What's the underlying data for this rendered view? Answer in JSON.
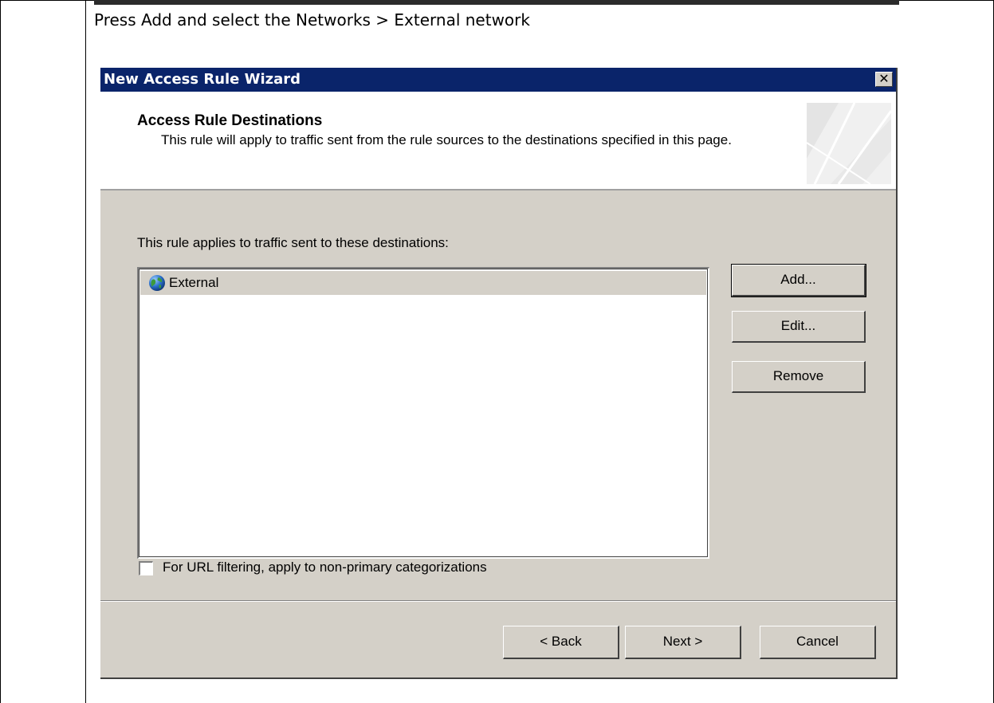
{
  "document": {
    "instruction": "Press Add and select the Networks > External network"
  },
  "dialog": {
    "title": "New Access Rule Wizard",
    "close_icon": "close-icon",
    "header": {
      "title": "Access Rule Destinations",
      "description": "This rule will apply to traffic sent from the rule sources to the destinations specified in this page."
    },
    "applies_label": "This rule applies to traffic sent to these destinations:",
    "destinations": [
      {
        "icon": "globe-icon",
        "label": "External"
      }
    ],
    "buttons": {
      "add": "Add...",
      "edit": "Edit...",
      "remove": "Remove"
    },
    "checkbox": {
      "label": "For URL filtering, apply to non-primary categorizations",
      "checked": false
    },
    "footer": {
      "back": "< Back",
      "next": "Next >",
      "cancel": "Cancel"
    },
    "colors": {
      "titlebar": "#0a246a",
      "dialog_bg": "#d4d0c8",
      "selection": "#d4d0c8"
    }
  }
}
